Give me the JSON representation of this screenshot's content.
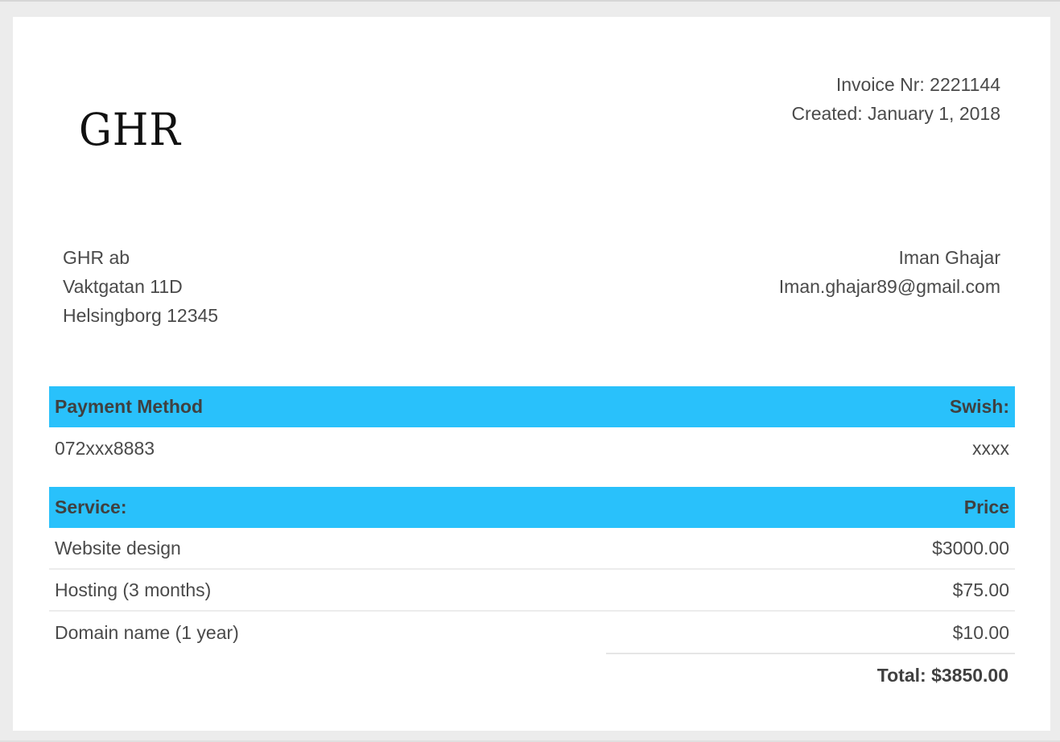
{
  "header": {
    "logo_text": "GHR",
    "invoice_number": "Invoice Nr: 2221144",
    "created": "Created: January 1, 2018"
  },
  "sender": {
    "company": "GHR ab",
    "street": "Vaktgatan 11D",
    "city": "Helsingborg 12345"
  },
  "recipient": {
    "name": "Iman Ghajar",
    "email": "Iman.ghajar89@gmail.com"
  },
  "payment": {
    "heading_left": "Payment Method",
    "heading_right": "Swish:",
    "detail_left": "072xxx8883",
    "detail_right": "xxxx"
  },
  "services": {
    "heading_left": "Service:",
    "heading_right": "Price",
    "items": [
      {
        "name": "Website design",
        "price": "$3000.00"
      },
      {
        "name": "Hosting (3 months)",
        "price": "$75.00"
      },
      {
        "name": "Domain name (1 year)",
        "price": "$10.00"
      }
    ],
    "total": "Total: $3850.00"
  },
  "colors": {
    "heading_bg": "#29c1fb",
    "text": "#4a4a4a",
    "page_bg": "#ececec"
  }
}
